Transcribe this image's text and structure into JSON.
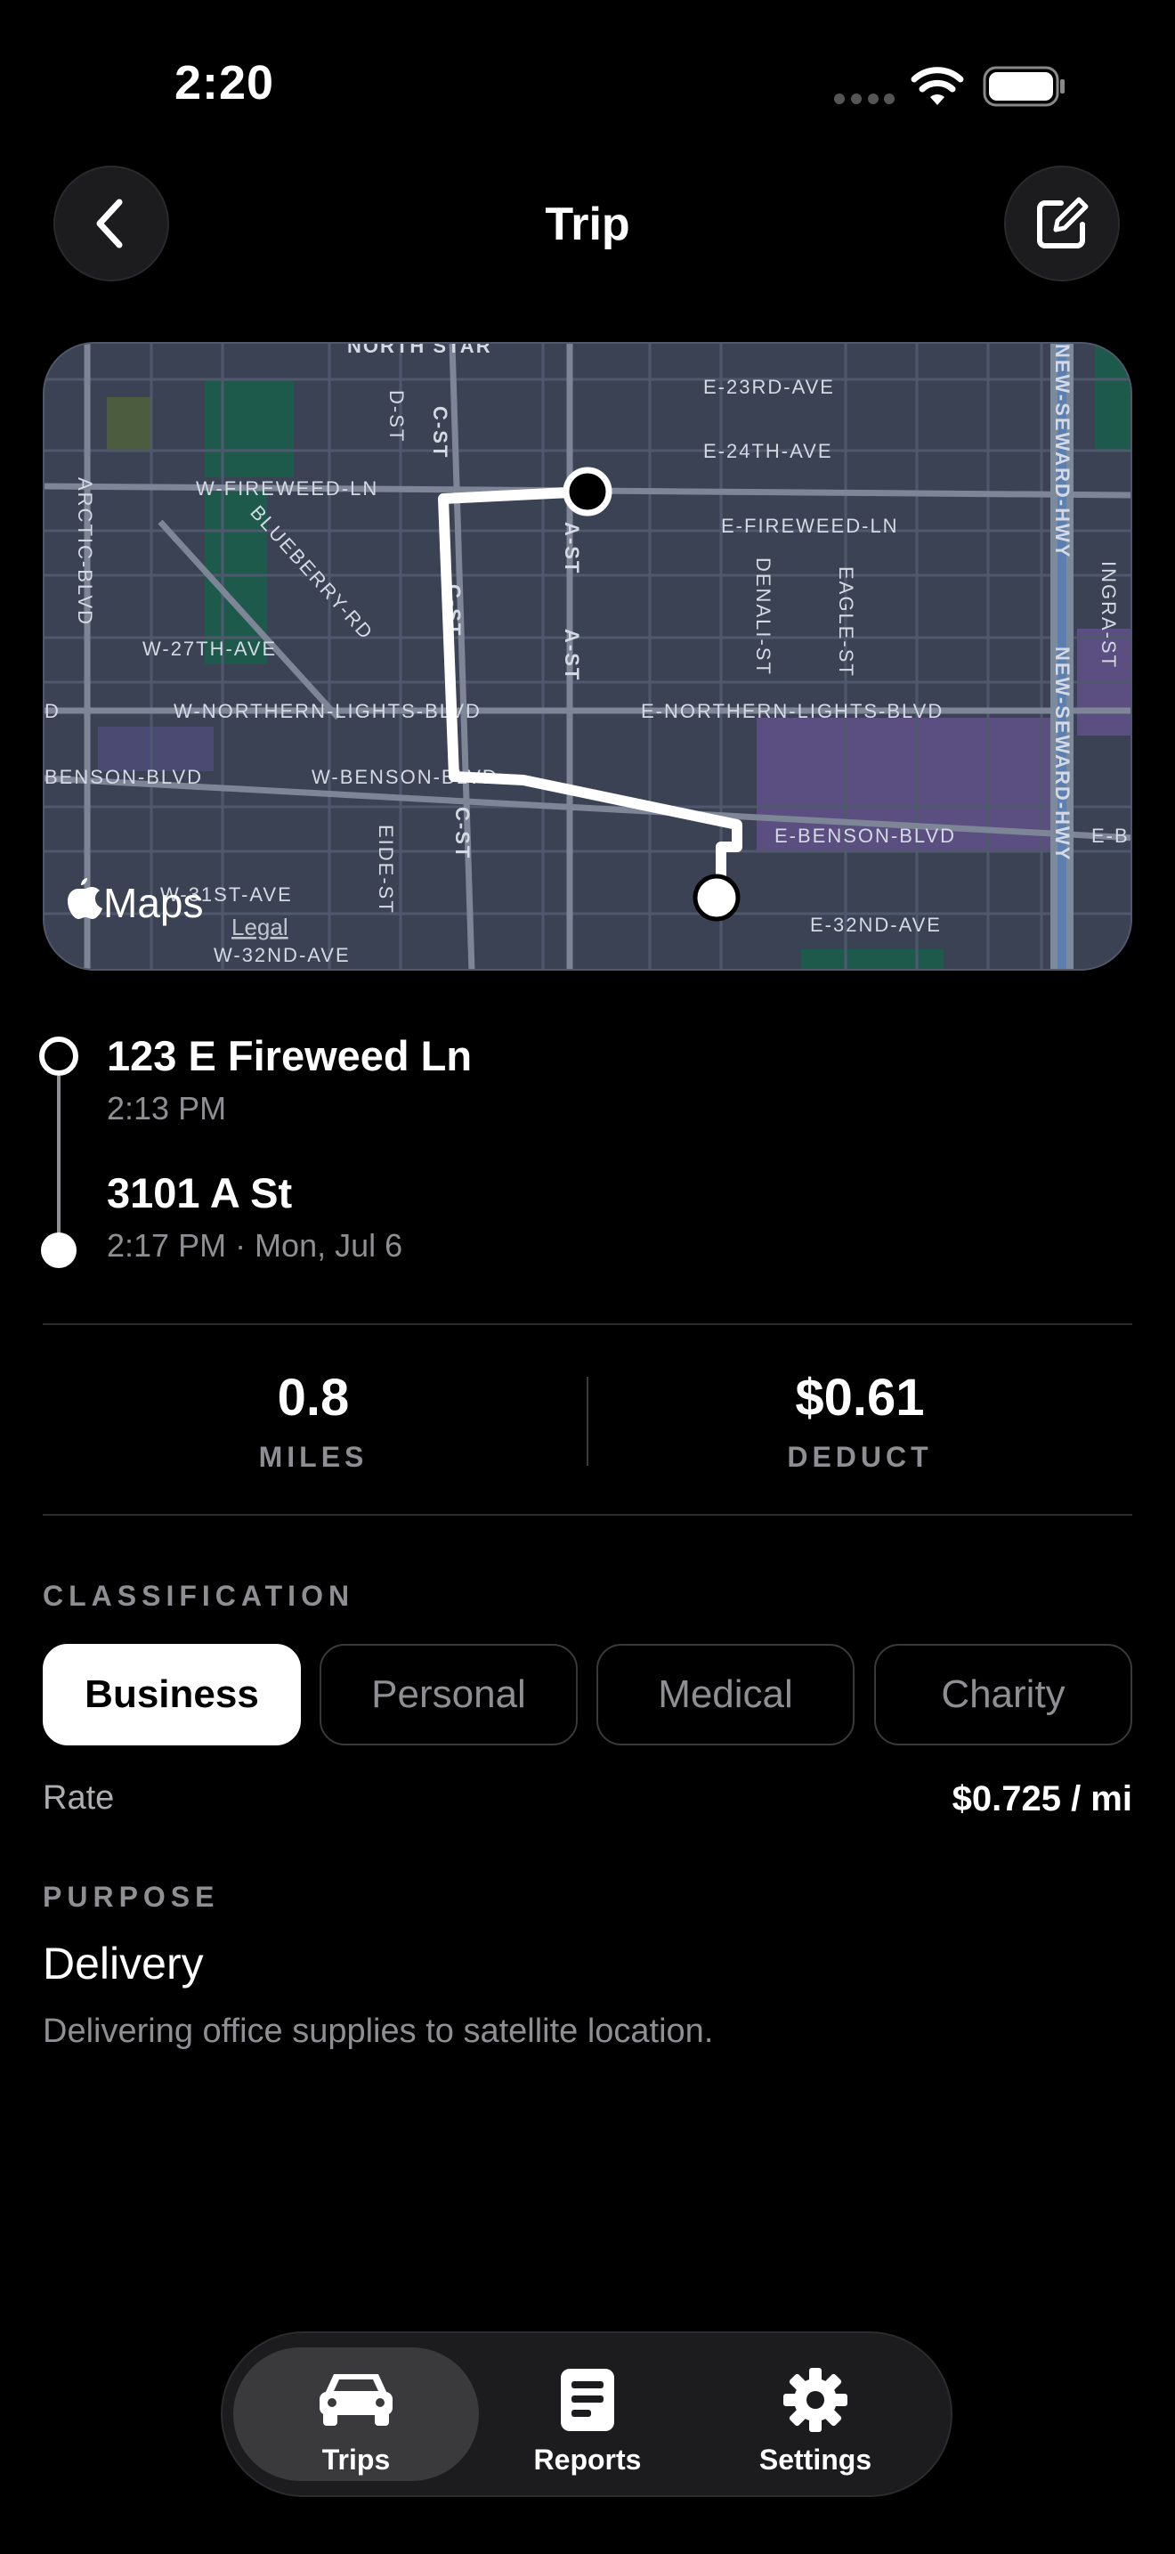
{
  "status": {
    "time": "2:20"
  },
  "header": {
    "title": "Trip"
  },
  "map": {
    "brand": "Maps",
    "legal": "Legal",
    "labels": {
      "north_star": "NORTH STAR",
      "e23": "E-23RD-AVE",
      "e24": "E-24TH-AVE",
      "w_fireweed": "W-FIREWEED-LN",
      "e_fireweed": "E-FIREWEED-LN",
      "w27": "W-27TH-AVE",
      "w_northern": "W-NORTHERN-LIGHTS-BLVD",
      "e_northern": "E-NORTHERN-LIGHTS-BLVD",
      "w_benson": "W-BENSON-BLVD",
      "benson_left": "BENSON-BLVD",
      "e_benson": "E-BENSON-BLVD",
      "e_b": "E-B",
      "w31": "W-31ST-AVE",
      "w32": "W-32ND-AVE",
      "e32": "E-32ND-AVE",
      "d_st": "D-ST",
      "c_st": "C-ST",
      "a_st": "A-ST",
      "denali": "DENALI-ST",
      "eagle": "EAGLE-ST",
      "arctic": "ARCTIC-BLVD",
      "blueberry": "BLUEBERRY-RD",
      "eide": "EIDE-ST",
      "seward": "NEW-SEWARD-HWY",
      "ingra": "INGRA-ST",
      "d_left": "D"
    }
  },
  "trip": {
    "start_address": "123 E Fireweed Ln",
    "start_time": "2:13 PM",
    "end_address": "3101 A St",
    "end_time": "2:17 PM · Mon, Jul 6"
  },
  "stats": {
    "miles_value": "0.8",
    "miles_label": "MILES",
    "deduct_value": "$0.61",
    "deduct_label": "DEDUCT"
  },
  "classification": {
    "label": "CLASSIFICATION",
    "options": [
      "Business",
      "Personal",
      "Medical",
      "Charity"
    ],
    "selected": "Business",
    "rate_label": "Rate",
    "rate_value": "$0.725 / mi"
  },
  "purpose": {
    "label": "PURPOSE",
    "title": "Delivery",
    "description": "Delivering office supplies to satellite location."
  },
  "tabs": [
    {
      "label": "Trips",
      "icon": "car-icon"
    },
    {
      "label": "Reports",
      "icon": "document-icon"
    },
    {
      "label": "Settings",
      "icon": "gear-icon"
    }
  ]
}
